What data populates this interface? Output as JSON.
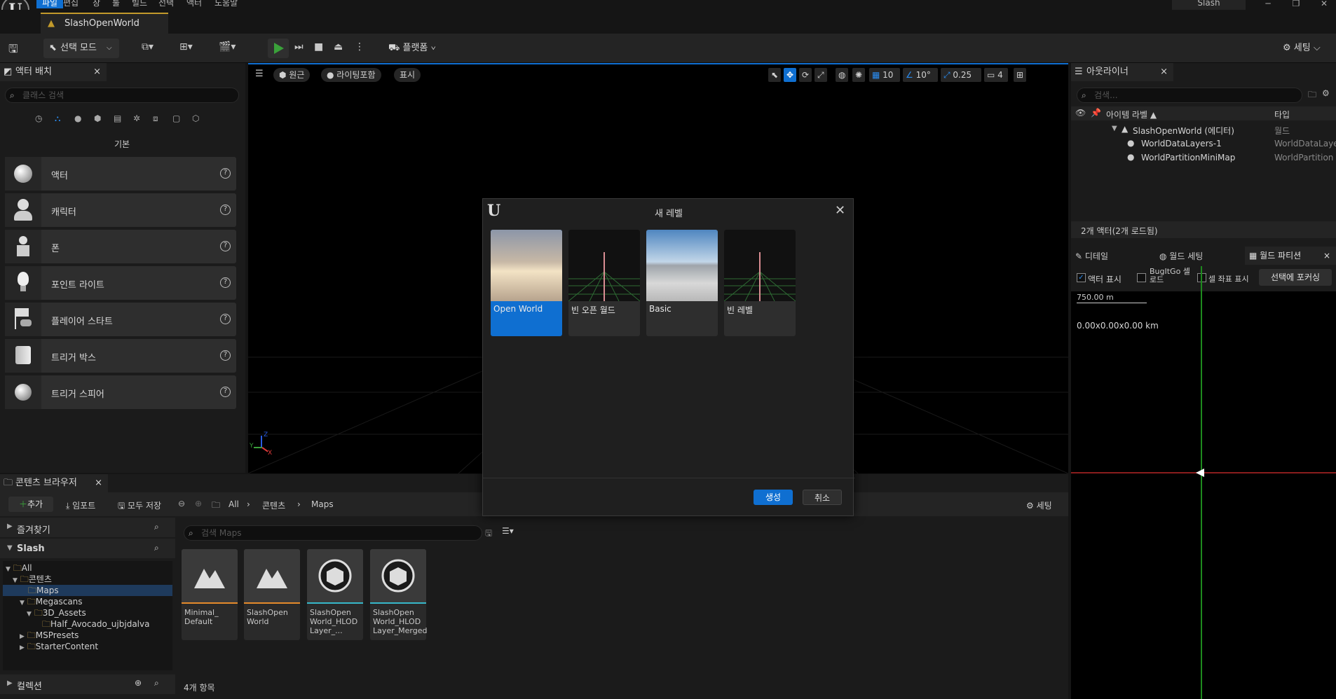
{
  "menu": {
    "items": [
      "파일",
      "편집",
      "창",
      "툴",
      "빌드",
      "선택",
      "액터",
      "도움말"
    ],
    "active_index": 0
  },
  "project_name": "Slash",
  "window_controls": [
    "─",
    "❐",
    "✕"
  ],
  "document_tab": {
    "label": "SlashOpenWorld"
  },
  "toolbar": {
    "select_mode": "선택 모드",
    "platform": "플랫폼",
    "settings": "세팅"
  },
  "place_actors": {
    "tab_label": "액터 배치",
    "search_placeholder": "클래스 검색",
    "category_label": "기본",
    "items": [
      {
        "label": "액터"
      },
      {
        "label": "캐릭터"
      },
      {
        "label": "폰"
      },
      {
        "label": "포인트 라이트"
      },
      {
        "label": "플레이어 스타트"
      },
      {
        "label": "트리거 박스"
      },
      {
        "label": "트리거 스피어"
      }
    ]
  },
  "viewport": {
    "perspective": "원근",
    "lighting": "라이팅포함",
    "show": "표시",
    "grid_snap": "10",
    "rotation_snap": "10°",
    "scale_snap": "0.25",
    "camera_speed": "4",
    "axis_x": "X",
    "axis_y": "Y",
    "axis_z": "Z"
  },
  "outliner": {
    "tab_label": "아웃라이너",
    "search_placeholder": "검색...",
    "col_label": "아이템 라벨 ▲",
    "col_type": "타입",
    "rows": [
      {
        "label": "SlashOpenWorld (에디터)",
        "type": "월드"
      },
      {
        "label": "WorldDataLayers-1",
        "type": "WorldDataLaye"
      },
      {
        "label": "WorldPartitionMiniMap",
        "type": "WorldPartition"
      }
    ],
    "status": "2개 액터(2개 로드됨)"
  },
  "details_tabs": {
    "details": "디테일",
    "world_settings": "월드 세팅",
    "world_partition": "월드 파티션"
  },
  "world_partition": {
    "show_actors": "액터 표시",
    "bugitgo_load": "BugItGo 셀 로드",
    "show_cell_coords": "셀 좌표 표시",
    "focus_selection": "선택에 포커싱",
    "scale": "750.00 m",
    "coords": "0.00x0.00x0.00 km"
  },
  "content_browser": {
    "tab_label": "콘텐츠 브라우저",
    "add": "추가",
    "import": "임포트",
    "save_all": "모두 저장",
    "breadcrumb": [
      "All",
      "콘텐츠",
      "Maps"
    ],
    "settings": "세팅",
    "favorites": "즐겨찾기",
    "project": "Slash",
    "collections": "컬렉션",
    "search_placeholder": "검색 Maps",
    "item_count": "4개 항목",
    "tree": [
      {
        "label": "All",
        "level": 0
      },
      {
        "label": "콘텐츠",
        "level": 1
      },
      {
        "label": "Maps",
        "level": 2,
        "selected": true
      },
      {
        "label": "Megascans",
        "level": 2
      },
      {
        "label": "3D_Assets",
        "level": 3
      },
      {
        "label": "Half_Avocado_ujbjdalva",
        "level": 4
      },
      {
        "label": "MSPresets",
        "level": 2
      },
      {
        "label": "StarterContent",
        "level": 2
      }
    ],
    "assets": [
      {
        "label": "Minimal_ Default",
        "color": "#e58a2b",
        "icon": "map-icon"
      },
      {
        "label": "SlashOpen World",
        "color": "#e58a2b",
        "icon": "map-icon"
      },
      {
        "label": "SlashOpen World_HLOD Layer_...",
        "color": "#36b8c9",
        "icon": "cube-icon"
      },
      {
        "label": "SlashOpen World_HLOD Layer_Merged",
        "color": "#36b8c9",
        "icon": "cube-icon"
      }
    ]
  },
  "new_level_dialog": {
    "title": "새 레벨",
    "templates": [
      {
        "label": "Open World",
        "selected": true
      },
      {
        "label": "빈 오픈 월드"
      },
      {
        "label": "Basic"
      },
      {
        "label": "빈 레벨"
      }
    ],
    "create": "생성",
    "cancel": "취소"
  },
  "colors": {
    "accent": "#0f6fd1",
    "level_tab": "#c29a2b",
    "play": "#3aa13a"
  }
}
